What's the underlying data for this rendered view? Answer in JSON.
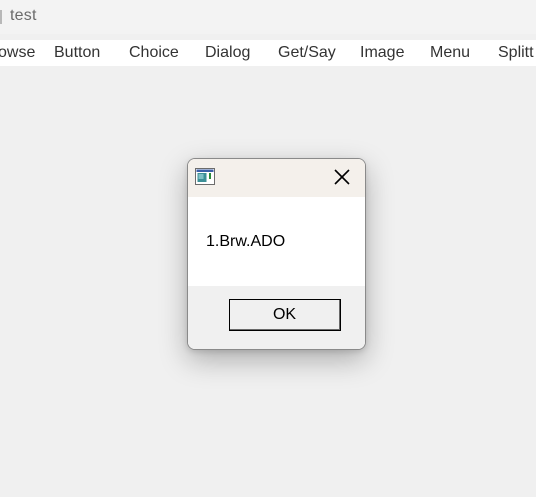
{
  "window": {
    "title": "test"
  },
  "menubar": {
    "items": [
      {
        "label": "owse"
      },
      {
        "label": "Button"
      },
      {
        "label": "Choice"
      },
      {
        "label": "Dialog"
      },
      {
        "label": "Get/Say"
      },
      {
        "label": "Image"
      },
      {
        "label": "Menu"
      },
      {
        "label": "Splitt"
      }
    ]
  },
  "dialog": {
    "icon": "app-window-icon",
    "close_icon": "close-icon",
    "message": "1.Brw.ADO",
    "ok_label": "OK"
  }
}
